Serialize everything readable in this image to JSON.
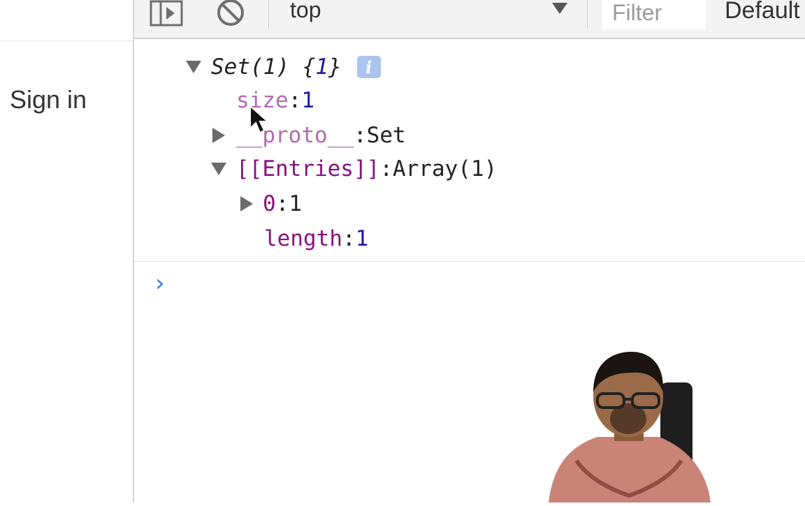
{
  "sidebar": {
    "sign_in": "Sign in"
  },
  "toolbar": {
    "context": "top",
    "filter_placeholder": "Filter",
    "levels": "Default"
  },
  "console": {
    "set_line": {
      "prefix": "Set(1) {",
      "value": "1",
      "suffix": "}",
      "info": "i"
    },
    "size": {
      "key": "size",
      "sep": ": ",
      "value": "1"
    },
    "proto": {
      "key": "__proto__",
      "sep": ": ",
      "value": "Set"
    },
    "entries": {
      "key": "[[Entries]]",
      "sep": ": ",
      "value": "Array(1)"
    },
    "entry0": {
      "key": "0",
      "sep": ": ",
      "value": "1"
    },
    "length": {
      "key": "length",
      "sep": ": ",
      "value": "1"
    },
    "prompt": "›"
  },
  "icons": [
    "sidebar-toggle-icon",
    "clear-console-icon",
    "dropdown-arrow-icon",
    "expand-icon",
    "collapse-icon",
    "info-icon",
    "mouse-cursor-icon",
    "prompt-icon"
  ],
  "colors": {
    "key_purple": "#881280",
    "number_blue": "#1a1aa6",
    "prompt_blue": "#2a7de1",
    "info_badge": "#a9c4ef"
  }
}
